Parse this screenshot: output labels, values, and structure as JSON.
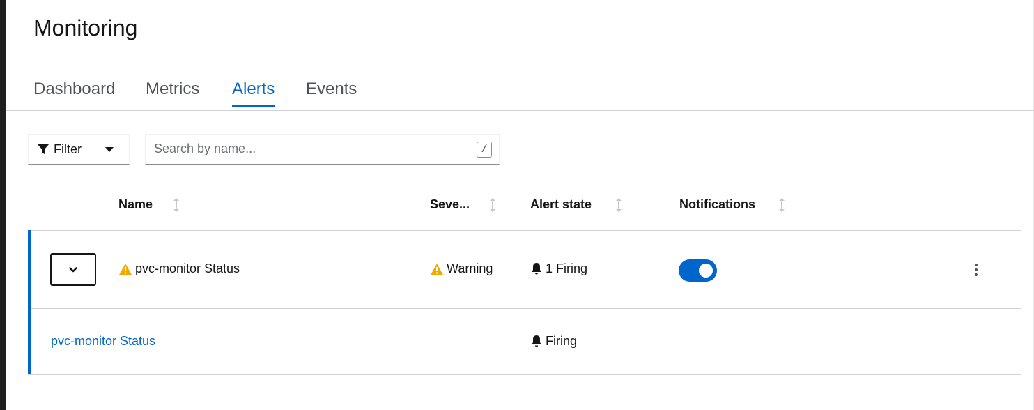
{
  "page": {
    "title": "Monitoring"
  },
  "tabs": [
    {
      "label": "Dashboard",
      "active": false
    },
    {
      "label": "Metrics",
      "active": false
    },
    {
      "label": "Alerts",
      "active": true
    },
    {
      "label": "Events",
      "active": false
    }
  ],
  "toolbar": {
    "filter_label": "Filter",
    "search_placeholder": "Search by name...",
    "search_value": "",
    "search_shortcut": "/"
  },
  "table": {
    "columns": [
      "Name",
      "Seve...",
      "Alert state",
      "Notifications"
    ],
    "rows": [
      {
        "name": "pvc-monitor Status",
        "severity": "Warning",
        "alert_state": "1 Firing",
        "notifications_enabled": true,
        "expanded": true,
        "children": [
          {
            "name": "pvc-monitor Status",
            "alert_state": "Firing"
          }
        ]
      }
    ]
  },
  "colors": {
    "accent": "#0066cc",
    "warning": "#f0ab00",
    "text": "#151515",
    "muted_text": "#4f5255",
    "border": "#d2d2d2"
  },
  "icons": [
    "filter-icon",
    "caret-down-icon",
    "sort-icon",
    "chevron-down-icon",
    "warning-icon",
    "bell-icon",
    "kebab-icon"
  ]
}
